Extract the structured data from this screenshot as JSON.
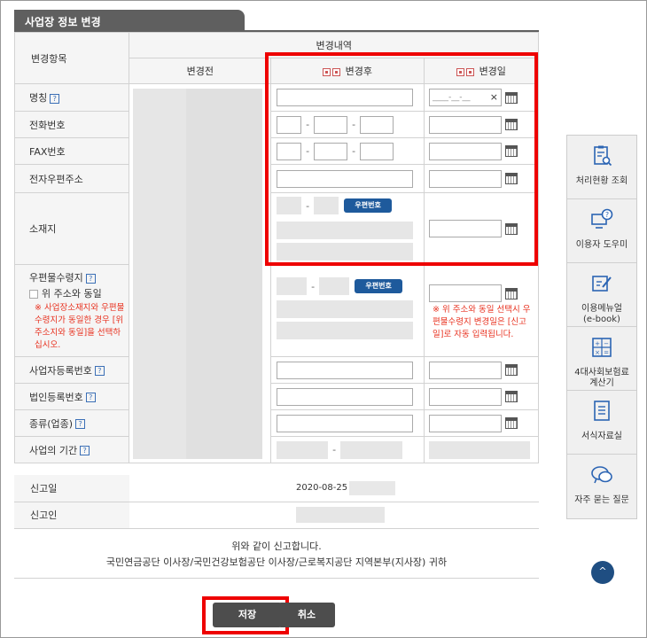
{
  "section_title": "사업장 정보 변경",
  "table": {
    "col_item": "변경항목",
    "col_details": "변경내역",
    "col_before": "변경전",
    "col_after": "변경후",
    "col_date": "변경일"
  },
  "rows": {
    "name": "명칭",
    "phone": "전화번호",
    "fax": "FAX번호",
    "email": "전자우편주소",
    "location": "소재지",
    "mailing": "우편물수령지",
    "biz_reg": "사업자등록번호",
    "corp_reg": "법인등록번호",
    "type": "종류(업종)",
    "period": "사업의 기간"
  },
  "date_placeholder": "____-__-__",
  "clear_symbol": "×",
  "help_symbol": "?",
  "dash": "-",
  "zip_button": "우편번호",
  "same_as_above_label": "위 주소와 동일",
  "mailing_note": "※ 사업장소재지와 우편물수령지가 동일한 경우 [위 주소지와 동일]을 선택하십시오.",
  "mailing_date_note": "※ 위 주소와 동일 선택시 우편물수령지 변경일은 [신고일]로 자동 입력됩니다.",
  "info": {
    "report_date_label": "신고일",
    "report_date_value": "2020-08-25",
    "reporter_label": "신고인"
  },
  "statement": {
    "line1": "위와 같이 신고합니다.",
    "line2": "국민연금공단 이사장/국민건강보험공단 이사장/근로복지공단 지역본부(지사장) 귀하"
  },
  "buttons": {
    "save": "저장",
    "cancel": "취소"
  },
  "sidebar": [
    {
      "label": "처리현황 조회",
      "icon": "clipboard-search-icon"
    },
    {
      "label": "이용자 도우미",
      "icon": "help-monitor-icon"
    },
    {
      "label": "이용메뉴얼\n(e-book)",
      "icon": "edit-book-icon"
    },
    {
      "label": "4대사회보험료\n계산기",
      "icon": "calculator-icon"
    },
    {
      "label": "서식자료실",
      "icon": "document-list-icon"
    },
    {
      "label": "자주 묻는 질문",
      "icon": "chat-bubble-icon"
    }
  ],
  "top_button": "^",
  "colors": {
    "highlight": "#ee0000",
    "header_dark": "#5f5f5f",
    "note_red": "#e8311f",
    "button_blue": "#1e5a9c"
  }
}
